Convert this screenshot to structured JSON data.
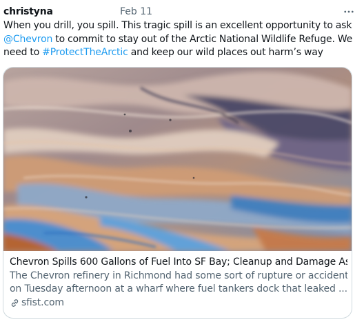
{
  "tweet": {
    "author": "christyna",
    "date": "Feb 11",
    "more_icon": "more-horizontal-icon",
    "text": {
      "part1": "When you drill, you spill. This tragic spill is an excellent opportunity to ask",
      "mention": "@Chevron",
      "part2": " to commit to stay out of the Arctic National Wildlife Refuge. We need to ",
      "hashtag": "#ProtectTheArctic",
      "part3": " and keep our wild places out harm’s way"
    }
  },
  "card": {
    "image_icon": "oil-spill-photo",
    "title": "Chevron Spills 600 Gallons of Fuel Into SF Bay; Cleanup and Damage As...",
    "description_line1": "The Chevron refinery in Richmond had some sort of rupture or accident",
    "description_line2": "on Tuesday afternoon at a wharf where fuel tankers dock that leaked ...",
    "domain": "sfist.com",
    "domain_icon": "link-icon"
  },
  "colors": {
    "link": "#1d9bf0",
    "secondary_text": "#536471",
    "border": "#cfd9de"
  }
}
